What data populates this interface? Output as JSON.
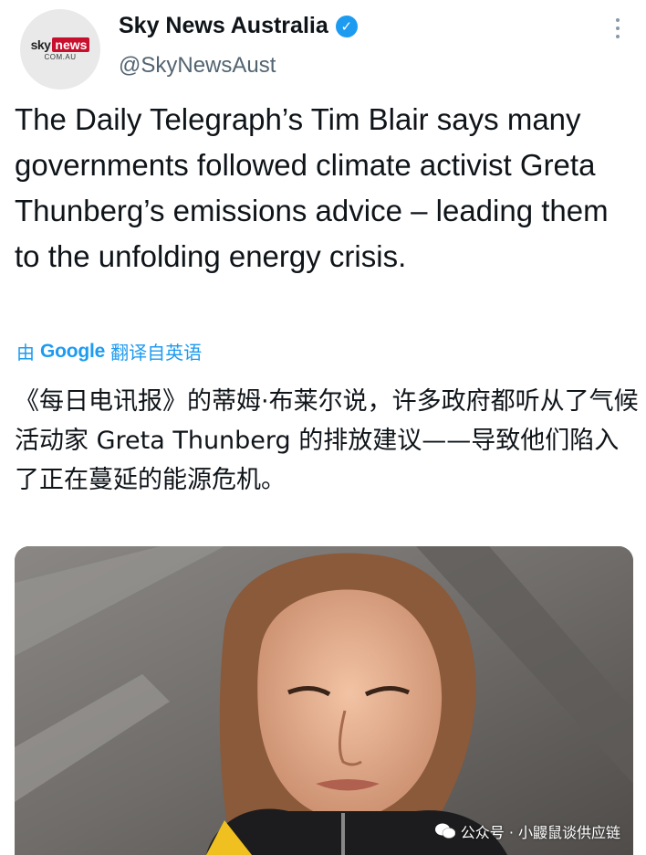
{
  "tweet": {
    "author": "Sky News Australia",
    "handle": "@SkyNewsAust",
    "avatar_logo": {
      "sky": "sky",
      "news": "news",
      "domain": "COM.AU"
    },
    "text": "The Daily Telegraph’s Tim Blair says many governments followed climate activist Greta Thunberg’s emissions advice – leading them to the unfolding energy crisis.",
    "translate": {
      "prefix": "由",
      "google": "Google",
      "suffix": "翻译自英语"
    },
    "translated_text": "《每日电讯报》的蒂姆·布莱尔说，许多政府都听从了气候活动家 Greta Thunberg 的排放建议——导致他们陷入了正在蔓延的能源危机。"
  },
  "watermark": "公众号 · 小鼹鼠谈供应链",
  "colors": {
    "accent": "#1d9bf0",
    "text": "#0f1419",
    "secondary": "#536471",
    "brand": "#c8102e"
  }
}
